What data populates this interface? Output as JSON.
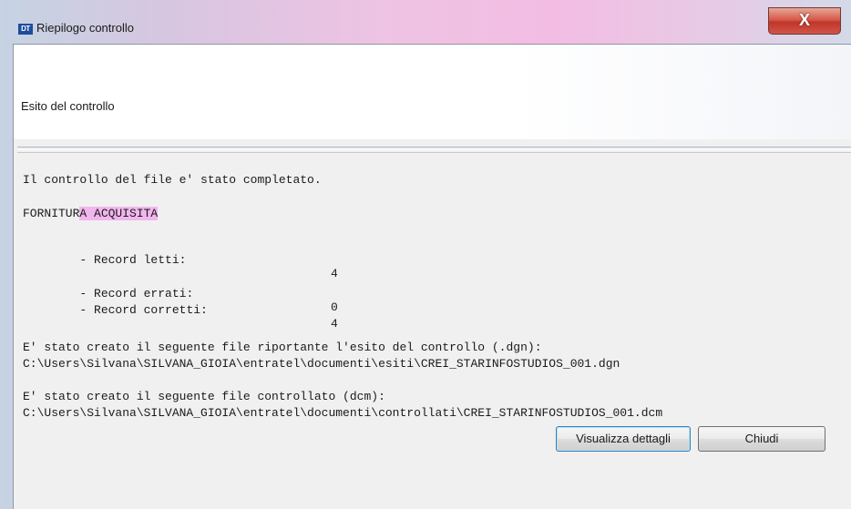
{
  "window": {
    "title": "Riepilogo controllo",
    "app_icon_text": "DT",
    "close_glyph": "X"
  },
  "header": {
    "section_title": "Esito del controllo"
  },
  "report": {
    "line_completed": "Il controllo del file e' stato completato.",
    "status_prefix": "FORNITUR",
    "status_highlight": "A ACQUISITA",
    "records": [
      {
        "label": "- Record letti:",
        "value": "4"
      },
      {
        "label": "- Record errati:",
        "value": "0"
      },
      {
        "label": "- Record corretti:",
        "value": "4"
      }
    ],
    "esito_file_msg": "E' stato creato il seguente file riportante l'esito del controllo (.dgn):",
    "esito_file_path": "C:\\Users\\Silvana\\SILVANA_GIOIA\\entratel\\documenti\\esiti\\CREI_STARINFOSTUDIOS_001.dgn",
    "controlled_file_msg": "E' stato creato il seguente file controllato (dcm):",
    "controlled_file_path": "C:\\Users\\Silvana\\SILVANA_GIOIA\\entratel\\documenti\\controllati\\CREI_STARINFOSTUDIOS_001.dcm"
  },
  "buttons": {
    "details_label": "Visualizza dettagli",
    "close_label": "Chiudi"
  }
}
